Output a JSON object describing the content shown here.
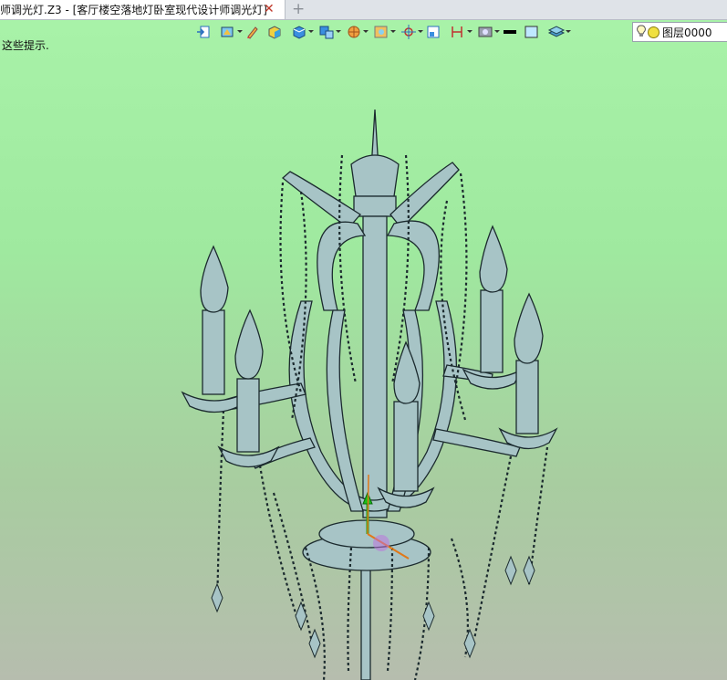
{
  "tab": {
    "title": "师调光灯.Z3 - [客厅楼空落地灯卧室现代设计师调光灯]",
    "close": "✕",
    "new_tab": "+"
  },
  "viewport": {
    "hint": "这些提示."
  },
  "toolbar": {
    "icons": [
      "exit-icon",
      "shade-mode-icon",
      "pencil-icon",
      "solid-cube-icon",
      "blue-cube-icon",
      "view-cube-icon",
      "render-sphere-icon",
      "image-icon",
      "snap-icon",
      "frame-icon",
      "dimension-icon",
      "display-icon",
      "line-color-swatch",
      "fill-color-swatch",
      "layer-stack-icon"
    ]
  },
  "layer": {
    "name": "图层0000"
  },
  "colors": {
    "bg_top": "#a8f2a8",
    "bg_bottom": "#b6bdae",
    "model": "#a7c4c6",
    "outline": "#1b2a2e"
  }
}
